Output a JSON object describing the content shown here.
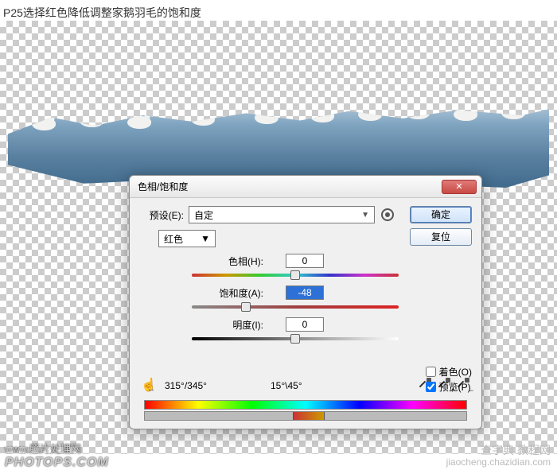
{
  "caption": "P25选择红色降低调整家鹅羽毛的饱和度",
  "dialog": {
    "title": "色相/饱和度",
    "close_glyph": "✕",
    "preset_label": "预设(E):",
    "preset_value": "自定",
    "channel_value": "红色",
    "ok_label": "确定",
    "reset_label": "复位",
    "hue_label": "色相(H):",
    "hue_value": "0",
    "sat_label": "饱和度(A):",
    "sat_value": "-48",
    "light_label": "明度(I):",
    "light_value": "0",
    "range_left": "315°/345°",
    "range_right": "15°\\45°",
    "colorize_label": "着色(O)",
    "preview_label": "预览(P)"
  },
  "watermarks": {
    "left_line1": "www.照片处理网",
    "left_line2": "PHOTOPS.COM",
    "right_site": "查字典   教程网",
    "right_sub": "jiaocheng.chazidian.com"
  }
}
